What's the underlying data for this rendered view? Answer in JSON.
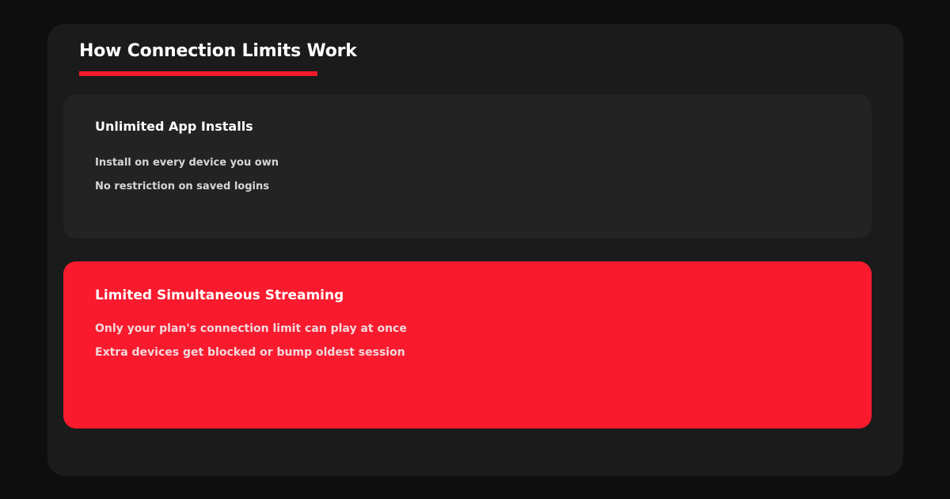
{
  "header": {
    "title": "How Connection Limits Work"
  },
  "cards": [
    {
      "title": "Unlimited App Installs",
      "lines": [
        "Install on every device you own",
        "No restriction on saved logins"
      ]
    },
    {
      "title": "Limited Simultaneous Streaming",
      "lines": [
        "Only your plan's connection limit can play at once",
        "Extra devices get blocked or bump oldest session"
      ]
    }
  ],
  "colors": {
    "accent": "#f21b2d",
    "panel": "#1b1b1b",
    "card_dark": "#232323",
    "card_highlight": "#f91a2e"
  }
}
